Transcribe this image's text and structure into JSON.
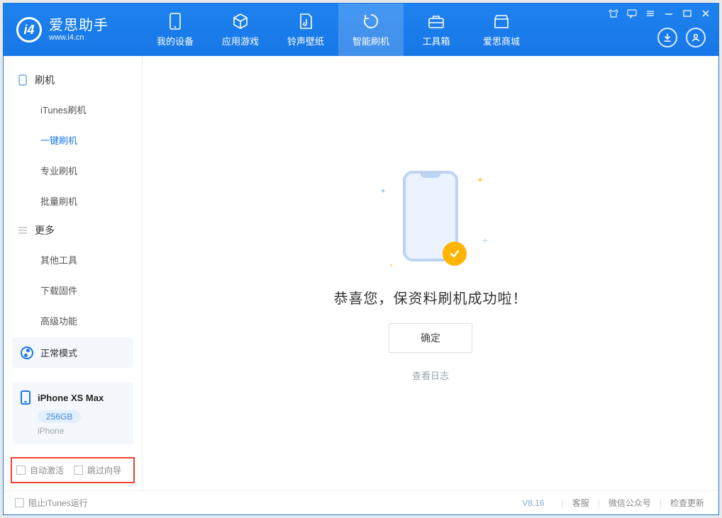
{
  "app": {
    "title": "爱思助手",
    "subtitle": "www.i4.cn"
  },
  "topTabs": {
    "device": "我的设备",
    "apps": "应用游戏",
    "ringtones": "铃声壁纸",
    "flash": "智能刷机",
    "toolbox": "工具箱",
    "store": "爱思商城"
  },
  "sidebar": {
    "groups": {
      "flash": "刷机",
      "more": "更多"
    },
    "items": {
      "itunes": "iTunes刷机",
      "oneclick": "一键刷机",
      "pro": "专业刷机",
      "batch": "批量刷机",
      "other_tools": "其他工具",
      "firmware": "下载固件",
      "advanced": "高级功能"
    }
  },
  "mode": {
    "label": "正常模式"
  },
  "device": {
    "name": "iPhone XS Max",
    "storage": "256GB",
    "type": "iPhone"
  },
  "options": {
    "auto_activate": "自动激活",
    "skip_guide": "跳过向导"
  },
  "main": {
    "success": "恭喜您，保资料刷机成功啦！",
    "ok": "确定",
    "view_log": "查看日志"
  },
  "status": {
    "block_itunes": "阻止iTunes运行",
    "version": "V8.16",
    "support": "客服",
    "wechat": "微信公众号",
    "update": "检查更新"
  }
}
